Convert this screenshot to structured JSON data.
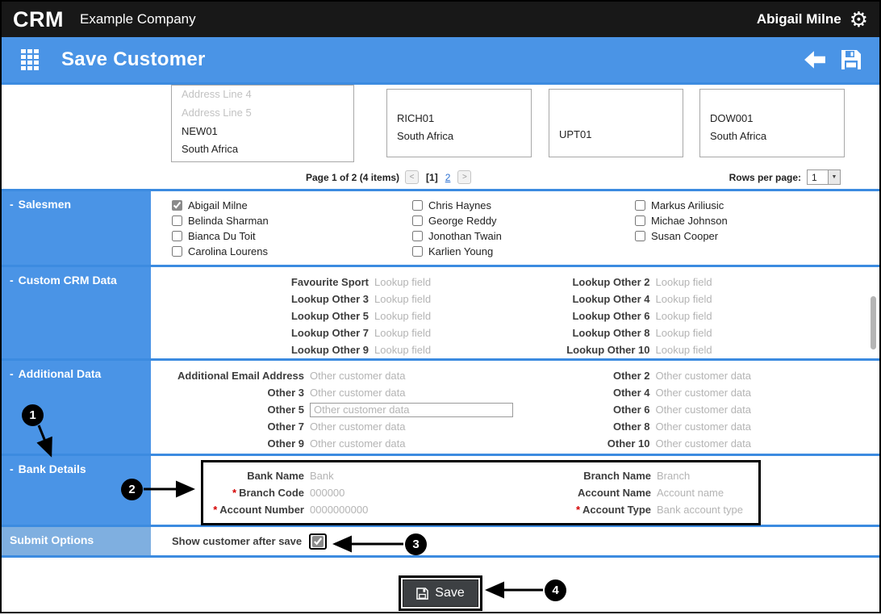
{
  "topbar": {
    "logo": "CRM",
    "company": "Example Company",
    "user": "Abigail Milne"
  },
  "header": {
    "title": "Save Customer"
  },
  "ui": {
    "collapse_glyph": "-",
    "gear_glyph": "⚙",
    "prev_glyph": "<",
    "next_glyph": ">",
    "dropdown_glyph": "▼"
  },
  "results": {
    "cards": [
      {
        "ghost1": "Address Line 4",
        "ghost2": "Address Line 5",
        "code": "NEW01",
        "country": "South Africa"
      },
      {
        "code": "RICH01",
        "country": "South Africa"
      },
      {
        "code": "UPT01"
      },
      {
        "code": "DOW001",
        "country": "South Africa"
      }
    ],
    "pagination": {
      "summary": "Page 1 of 2 (4 items)",
      "current_page": "[1]",
      "page2": "2",
      "rows_label": "Rows per page:",
      "rows_value": "1"
    }
  },
  "salesmen": {
    "title": "Salesmen",
    "col1": [
      {
        "label": "Abigail Milne",
        "checked": true
      },
      {
        "label": "Belinda Sharman",
        "checked": false
      },
      {
        "label": "Bianca Du Toit",
        "checked": false
      },
      {
        "label": "Carolina Lourens",
        "checked": false
      }
    ],
    "col2": [
      {
        "label": "Chris Haynes",
        "checked": false
      },
      {
        "label": "George Reddy",
        "checked": false
      },
      {
        "label": "Jonothan Twain",
        "checked": false
      },
      {
        "label": "Karlien Young",
        "checked": false
      }
    ],
    "col3": [
      {
        "label": "Markus Ariliusic",
        "checked": false
      },
      {
        "label": "Michae Johnson",
        "checked": false
      },
      {
        "label": "Susan Cooper",
        "checked": false
      }
    ]
  },
  "custom_crm": {
    "title": "Custom CRM Data",
    "left": [
      {
        "label": "Favourite Sport",
        "placeholder": "Lookup field"
      },
      {
        "label": "Lookup Other 3",
        "placeholder": "Lookup field"
      },
      {
        "label": "Lookup Other 5",
        "placeholder": "Lookup field"
      },
      {
        "label": "Lookup Other 7",
        "placeholder": "Lookup field"
      },
      {
        "label": "Lookup Other 9",
        "placeholder": "Lookup field"
      }
    ],
    "right": [
      {
        "label": "Lookup Other 2",
        "placeholder": "Lookup field"
      },
      {
        "label": "Lookup Other 4",
        "placeholder": "Lookup field"
      },
      {
        "label": "Lookup Other 6",
        "placeholder": "Lookup field"
      },
      {
        "label": "Lookup Other 8",
        "placeholder": "Lookup field"
      },
      {
        "label": "Lookup Other 10",
        "placeholder": "Lookup field"
      }
    ]
  },
  "additional": {
    "title": "Additional Data",
    "left": [
      {
        "label": "Additional Email Address",
        "placeholder": "Other customer data"
      },
      {
        "label": "Other 3",
        "placeholder": "Other customer data"
      },
      {
        "label": "Other 5",
        "placeholder": "Other customer data"
      },
      {
        "label": "Other 7",
        "placeholder": "Other customer data"
      },
      {
        "label": "Other 9",
        "placeholder": "Other customer data"
      }
    ],
    "right": [
      {
        "label": "Other 2",
        "placeholder": "Other customer data"
      },
      {
        "label": "Other 4",
        "placeholder": "Other customer data"
      },
      {
        "label": "Other 6",
        "placeholder": "Other customer data"
      },
      {
        "label": "Other 8",
        "placeholder": "Other customer data"
      },
      {
        "label": "Other 10",
        "placeholder": "Other customer data"
      }
    ]
  },
  "bank": {
    "title": "Bank Details",
    "required_marker": "*",
    "left": [
      {
        "label": "Bank Name",
        "placeholder": "Bank",
        "required": false
      },
      {
        "label": "Branch Code",
        "placeholder": "000000",
        "required": true
      },
      {
        "label": "Account Number",
        "placeholder": "0000000000",
        "required": true
      }
    ],
    "right": [
      {
        "label": "Branch Name",
        "placeholder": "Branch",
        "required": false
      },
      {
        "label": "Account Name",
        "placeholder": "Account name",
        "required": false
      },
      {
        "label": "Account Type",
        "placeholder": "Bank account type",
        "required": true
      }
    ]
  },
  "submit": {
    "title": "Submit Options",
    "label": "Show customer after save",
    "checked": true
  },
  "footer": {
    "save_label": "Save"
  },
  "annotations": {
    "n1": "1",
    "n2": "2",
    "n3": "3",
    "n4": "4"
  },
  "colors": {
    "topbar_black": "#181818",
    "primary_blue": "#4a94e6",
    "submit_blue": "#7fafe0",
    "divider_blue": "#3c8be0",
    "required_red": "#d40000",
    "link_blue": "#2a6fd1"
  }
}
